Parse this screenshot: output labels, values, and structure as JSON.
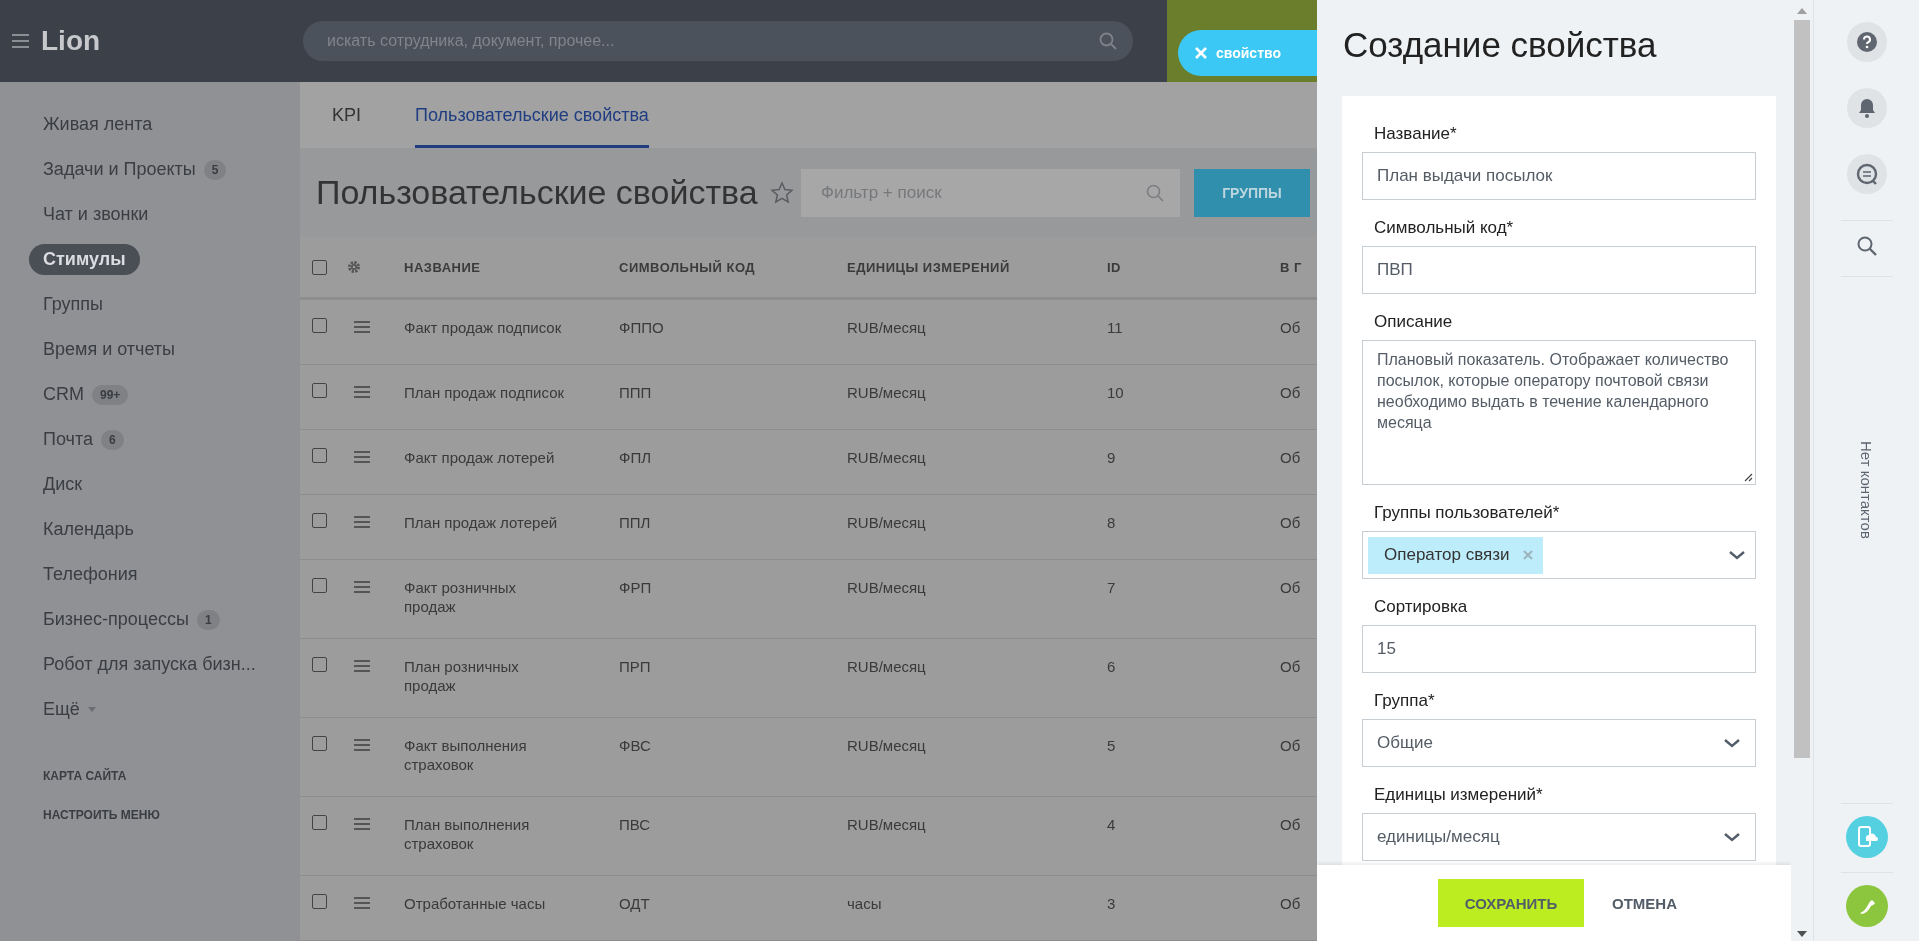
{
  "header": {
    "logo": "Lion",
    "search": {
      "placeholder": "искать сотрудника, документ, прочее..."
    },
    "close_button": {
      "label": "свойство"
    }
  },
  "sidebar": {
    "items": [
      {
        "label": "Живая лента",
        "selected": false
      },
      {
        "label": "Задачи и Проекты",
        "badge": "5",
        "selected": false
      },
      {
        "label": "Чат и звонки",
        "selected": false
      },
      {
        "label": "Стимулы",
        "selected": true
      },
      {
        "label": "Группы",
        "selected": false
      },
      {
        "label": "Время и отчеты",
        "selected": false
      },
      {
        "label": "CRM",
        "badge": "99+",
        "selected": false
      },
      {
        "label": "Почта",
        "badge": "6",
        "selected": false
      },
      {
        "label": "Диск",
        "selected": false
      },
      {
        "label": "Календарь",
        "selected": false
      },
      {
        "label": "Телефония",
        "selected": false
      },
      {
        "label": "Бизнес-процессы",
        "badge": "1",
        "selected": false
      },
      {
        "label": "Робот для запуска бизн...",
        "selected": false
      },
      {
        "label": "Ещё",
        "kind": "more",
        "selected": false
      }
    ],
    "footer_links": [
      "КАРТА САЙТА",
      "НАСТРОИТЬ МЕНЮ"
    ]
  },
  "tabs": [
    {
      "label": "KPI",
      "selected": false
    },
    {
      "label": "Пользовательские свойства",
      "selected": true
    }
  ],
  "page": {
    "title": "Пользовательские свойства",
    "filter": {
      "placeholder": "Фильтр + поиск"
    },
    "groups_button": "ГРУППЫ"
  },
  "table": {
    "all_checked": false,
    "columns": [
      "НАЗВАНИЕ",
      "СИМВОЛЬНЫЙ КОД",
      "ЕДИНИЦЫ ИЗМЕРЕНИЙ",
      "ID",
      "В Г"
    ],
    "rows": [
      {
        "checked": false,
        "cells": [
          "Факт продаж подписок",
          "ФППО",
          "RUB/месяц",
          "11",
          "Об"
        ]
      },
      {
        "checked": false,
        "cells": [
          "План продаж подписок",
          "ППП",
          "RUB/месяц",
          "10",
          "Об"
        ]
      },
      {
        "checked": false,
        "cells": [
          "Факт продаж лотерей",
          "ФПЛ",
          "RUB/месяц",
          "9",
          "Об"
        ]
      },
      {
        "checked": false,
        "cells": [
          "План продаж лотерей",
          "ППЛ",
          "RUB/месяц",
          "8",
          "Об"
        ]
      },
      {
        "checked": false,
        "cells": [
          "Факт розничных\nпродаж",
          "ФРП",
          "RUB/месяц",
          "7",
          "Об"
        ]
      },
      {
        "checked": false,
        "cells": [
          "План розничных\nпродаж",
          "ПРП",
          "RUB/месяц",
          "6",
          "Об"
        ]
      },
      {
        "checked": false,
        "cells": [
          "Факт выполнения\nстраховок",
          "ФВС",
          "RUB/месяц",
          "5",
          "Об"
        ]
      },
      {
        "checked": false,
        "cells": [
          "План выполнения\nстраховок",
          "ПВС",
          "RUB/месяц",
          "4",
          "Об"
        ]
      },
      {
        "checked": false,
        "cells": [
          "Отработанные часы",
          "ОДТ",
          "часы",
          "3",
          "Об"
        ]
      }
    ]
  },
  "panel": {
    "title": "Создание свойства",
    "fields": [
      {
        "kind": "text",
        "label": "Название*",
        "value": "План выдачи посылок"
      },
      {
        "kind": "text",
        "label": "Символьный код*",
        "value": "ПВП"
      },
      {
        "kind": "textarea",
        "label": "Описание",
        "value": "Плановый показатель. Отображает количество посылок, которые оператору почтовой связи необходимо выдать в течение календарного месяца"
      },
      {
        "kind": "multiselect",
        "label": "Группы пользователей*",
        "tags": [
          "Оператор связи"
        ]
      },
      {
        "kind": "text",
        "label": "Сортировка",
        "value": "15"
      },
      {
        "kind": "select",
        "label": "Группа*",
        "value": "Общие"
      },
      {
        "kind": "select",
        "label": "Единицы измерений*",
        "value": "единицы/месяц"
      }
    ],
    "buttons": [
      {
        "label": "СОХРАНИТЬ",
        "kind": "primary"
      },
      {
        "label": "ОТМЕНА",
        "kind": "link"
      }
    ]
  },
  "right_bar": {
    "empty_text": "Нет контактов"
  }
}
